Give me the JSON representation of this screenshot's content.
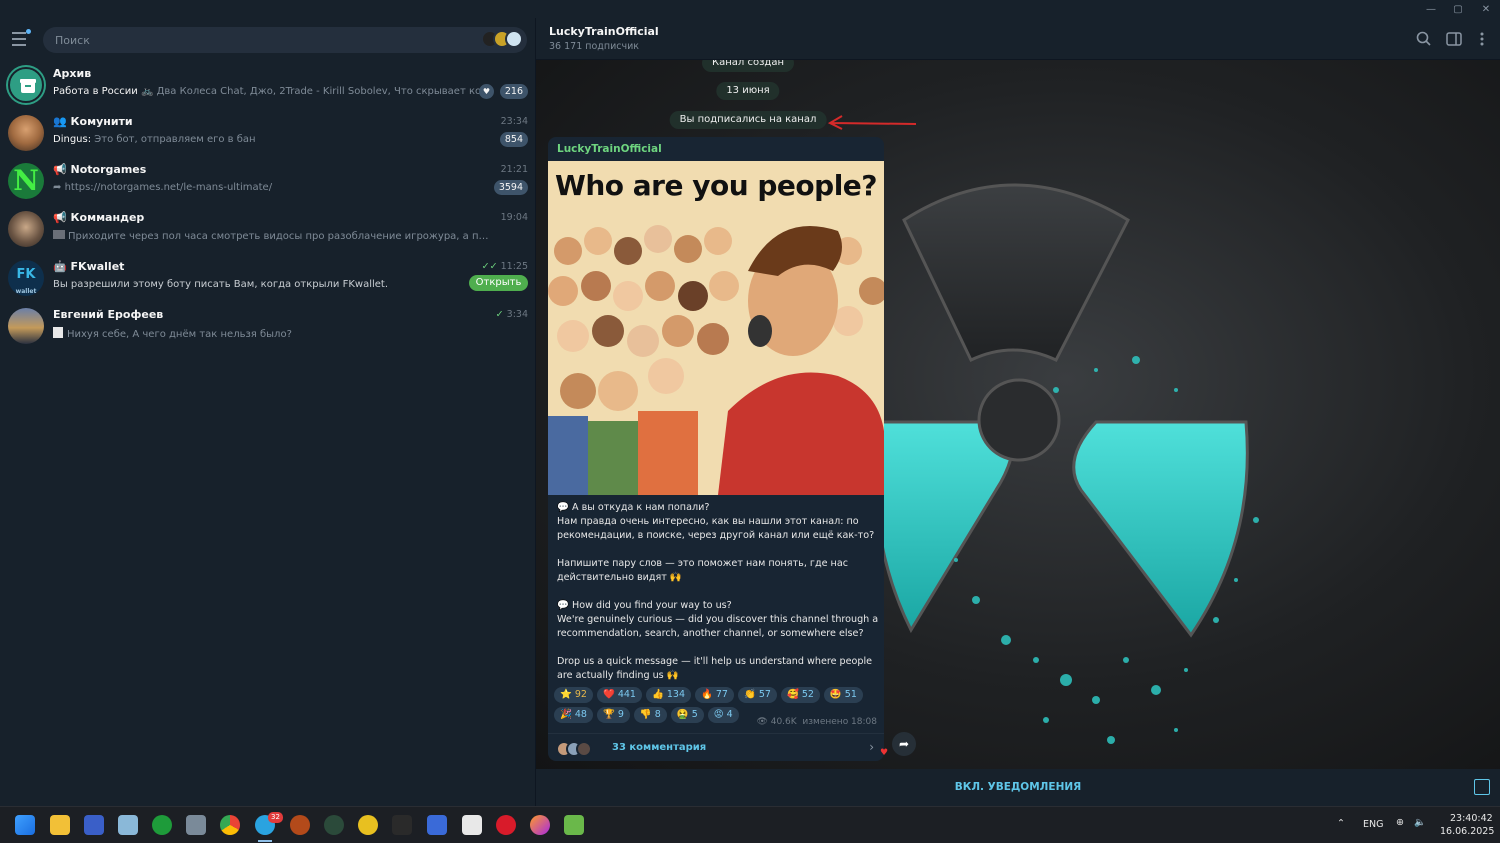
{
  "search": {
    "placeholder": "Поиск"
  },
  "chats": [
    {
      "title": "Архив",
      "preview_bold": "Работа в России",
      "preview": " 🚲 Два Колеса Chat, Джо, 2Trade - Kirill Sobolev, Что скрывает кожа...",
      "badge": "216"
    },
    {
      "title": "Комунити",
      "time": "23:34",
      "sender": "Dingus:",
      "preview": " Это бот, отправляем его в бан",
      "badge": "854"
    },
    {
      "title": "Notorgames",
      "time": "21:21",
      "preview": "https://notorgames.net/le-mans-ultimate/",
      "badge": "3594"
    },
    {
      "title": "Коммандер",
      "time": "19:04",
      "preview": "Приходите через пол часа смотреть видосы про разоблачение игрожура, а потом может в ..."
    },
    {
      "title": "FKwallet",
      "time": "11:25",
      "preview": "Вы разрешили этому боту писать Вам, когда открыли FKwallet.",
      "button": "Открыть"
    },
    {
      "title": "Евгений Ерофеев",
      "time": "3:34",
      "preview": "Нихуя себе, А чего днём так нельзя было?"
    }
  ],
  "channel": {
    "title": "LuckyTrainOfficial",
    "subtitle": "36 171 подписчик"
  },
  "service": {
    "created": "Канал создан",
    "date": "13 июня",
    "subscribed": "Вы подписались на канал"
  },
  "post": {
    "author": "LuckyTrainOfficial",
    "image_title": "Who are you people?",
    "paragraphs": [
      "💬 А вы откуда к нам попали?\nНам правда очень интересно, как вы нашли этот канал: по рекомендации, в поиске, через другой канал или ещё как-то?",
      "Напишите пару слов — это поможет нам понять, где нас действительно видят 🙌",
      "💬 How did you find your way to us?\nWe're genuinely curious — did you discover this channel through a recommendation, search, another channel, or somewhere else?",
      "Drop us a quick message — it'll help us understand where people are actually finding us 🙌"
    ],
    "reactions_row1": [
      {
        "emoji": "⭐",
        "count": "92"
      },
      {
        "emoji": "❤️",
        "count": "441"
      },
      {
        "emoji": "👍",
        "count": "134"
      },
      {
        "emoji": "🔥",
        "count": "77"
      },
      {
        "emoji": "👏",
        "count": "57"
      },
      {
        "emoji": "🥰",
        "count": "52"
      },
      {
        "emoji": "🤩",
        "count": "51"
      }
    ],
    "reactions_row2": [
      {
        "emoji": "🎉",
        "count": "48"
      },
      {
        "emoji": "🏆",
        "count": "9"
      },
      {
        "emoji": "👎",
        "count": "8"
      },
      {
        "emoji": "🤮",
        "count": "5"
      },
      {
        "emoji": "😡",
        "count": "4"
      }
    ],
    "views": "40.6K",
    "edited": "изменено 18:08",
    "comments": "33 комментария"
  },
  "bottom": {
    "notifications": "ВКЛ. УВЕДОМЛЕНИЯ"
  },
  "taskbar": {
    "telegram_badge": "32",
    "lang": "ENG",
    "time": "23:40:42",
    "date": "16.06.2025"
  },
  "colors": {
    "accent": "#5fc6e8",
    "author": "#6ed47f",
    "open_button": "#4fae4e",
    "sidebar": "#17212b"
  }
}
